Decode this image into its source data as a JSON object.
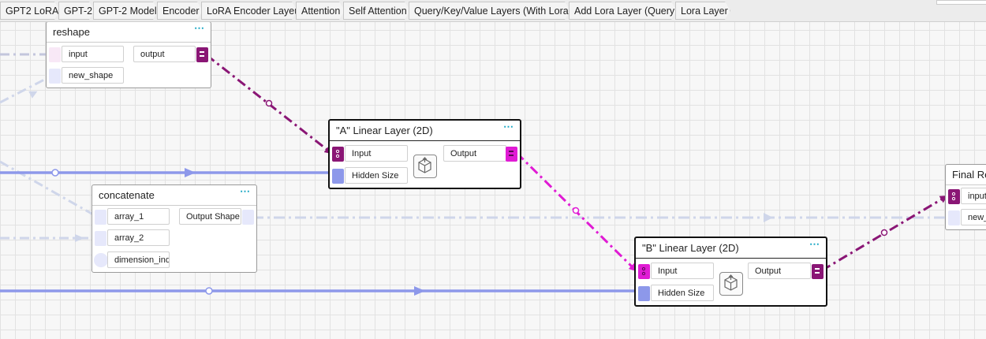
{
  "breadcrumb": [
    "GPT2 LoRA",
    "GPT-2",
    "GPT-2 Model",
    "Encoder",
    "LoRA Encoder Layer",
    "Attention",
    "Self Attention",
    "Query/Key/Value Layers (With Lora)",
    "Add Lora Layer (Query)",
    "Lora Layer"
  ],
  "nodes": {
    "reshape": {
      "title": "reshape",
      "menu": "⋯",
      "inputs": [
        "input",
        "new_shape"
      ],
      "outputs": [
        "output"
      ]
    },
    "a_linear": {
      "title": "\"A\" Linear Layer (2D)",
      "menu": "⋯",
      "inputs": [
        "Input",
        "Hidden Size"
      ],
      "outputs": [
        "Output"
      ]
    },
    "concatenate": {
      "title": "concatenate",
      "menu": "⋯",
      "inputs": [
        "array_1",
        "array_2",
        "dimension_inde"
      ],
      "outputs": [
        "Output Shape"
      ]
    },
    "b_linear": {
      "title": "\"B\" Linear Layer (2D)",
      "menu": "⋯",
      "inputs": [
        "Input",
        "Hidden Size"
      ],
      "outputs": [
        "Output"
      ]
    },
    "final": {
      "title": "Final Re",
      "inputs": [
        "input",
        "new_s"
      ]
    }
  },
  "colors": {
    "purple": "#8a1675",
    "magenta": "#e01bd4",
    "blue": "#8d98ea",
    "faint": "#c9cde8"
  }
}
